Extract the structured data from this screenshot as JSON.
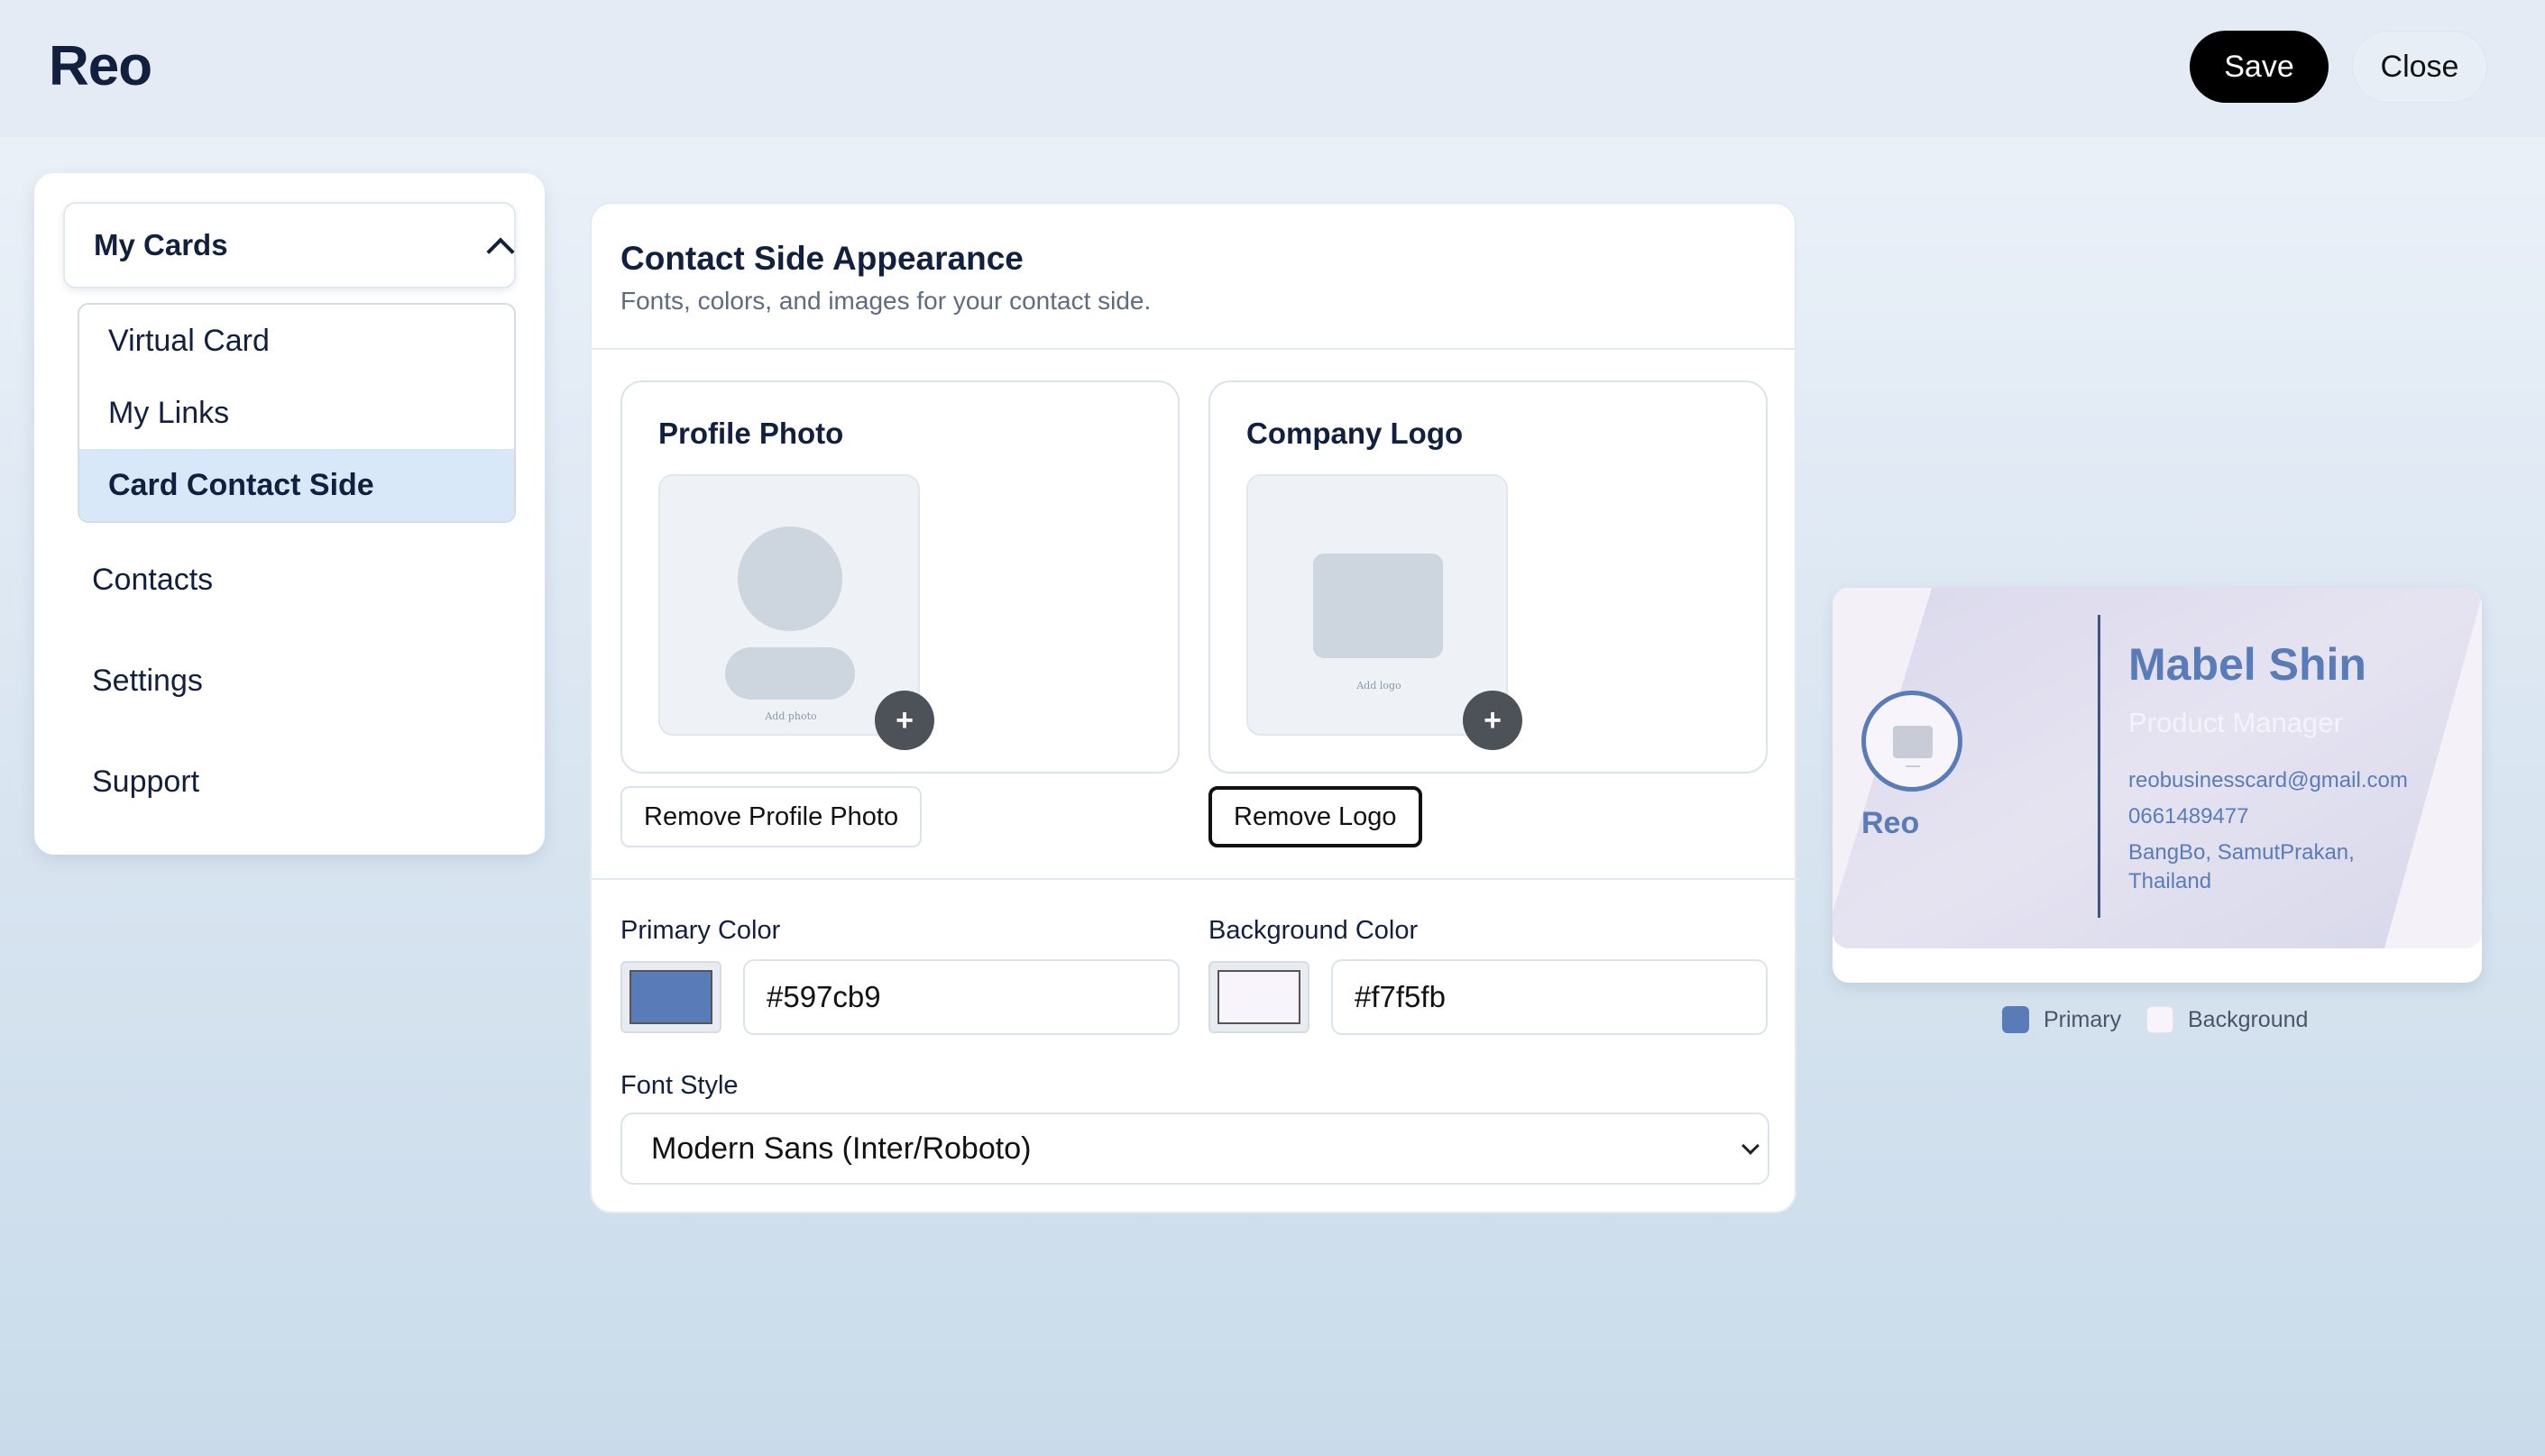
{
  "header": {
    "brand": "Reo",
    "save_label": "Save",
    "close_label": "Close"
  },
  "sidebar": {
    "group_label": "My Cards",
    "sub_items": [
      "Virtual Card",
      "My Links",
      "Card Contact Side"
    ],
    "items": [
      "Contacts",
      "Settings",
      "Support"
    ]
  },
  "panel": {
    "title": "Contact Side Appearance",
    "subtitle": "Fonts, colors, and images for your contact side.",
    "profile_photo": {
      "title": "Profile Photo",
      "hint": "Add photo",
      "remove_label": "Remove Profile Photo"
    },
    "company_logo": {
      "title": "Company Logo",
      "hint": "Add logo",
      "remove_label": "Remove Logo"
    },
    "primary_color": {
      "label": "Primary Color",
      "value": "#597cb9"
    },
    "background_color": {
      "label": "Background Color",
      "value": "#f7f5fb"
    },
    "font_style": {
      "label": "Font Style",
      "value": "Modern Sans (Inter/Roboto)"
    }
  },
  "preview": {
    "brand": "Reo",
    "name": "Mabel Shin",
    "role": "Product Manager",
    "email": "reobusinesscard@gmail.com",
    "phone": "0661489477",
    "address_line1": "BangBo, SamutPrakan,",
    "address_line2": "Thailand",
    "legend_primary": "Primary",
    "legend_background": "Background"
  },
  "colors": {
    "primary": "#597cb9",
    "background": "#f7f5fb",
    "accent_dark": "#000000"
  }
}
